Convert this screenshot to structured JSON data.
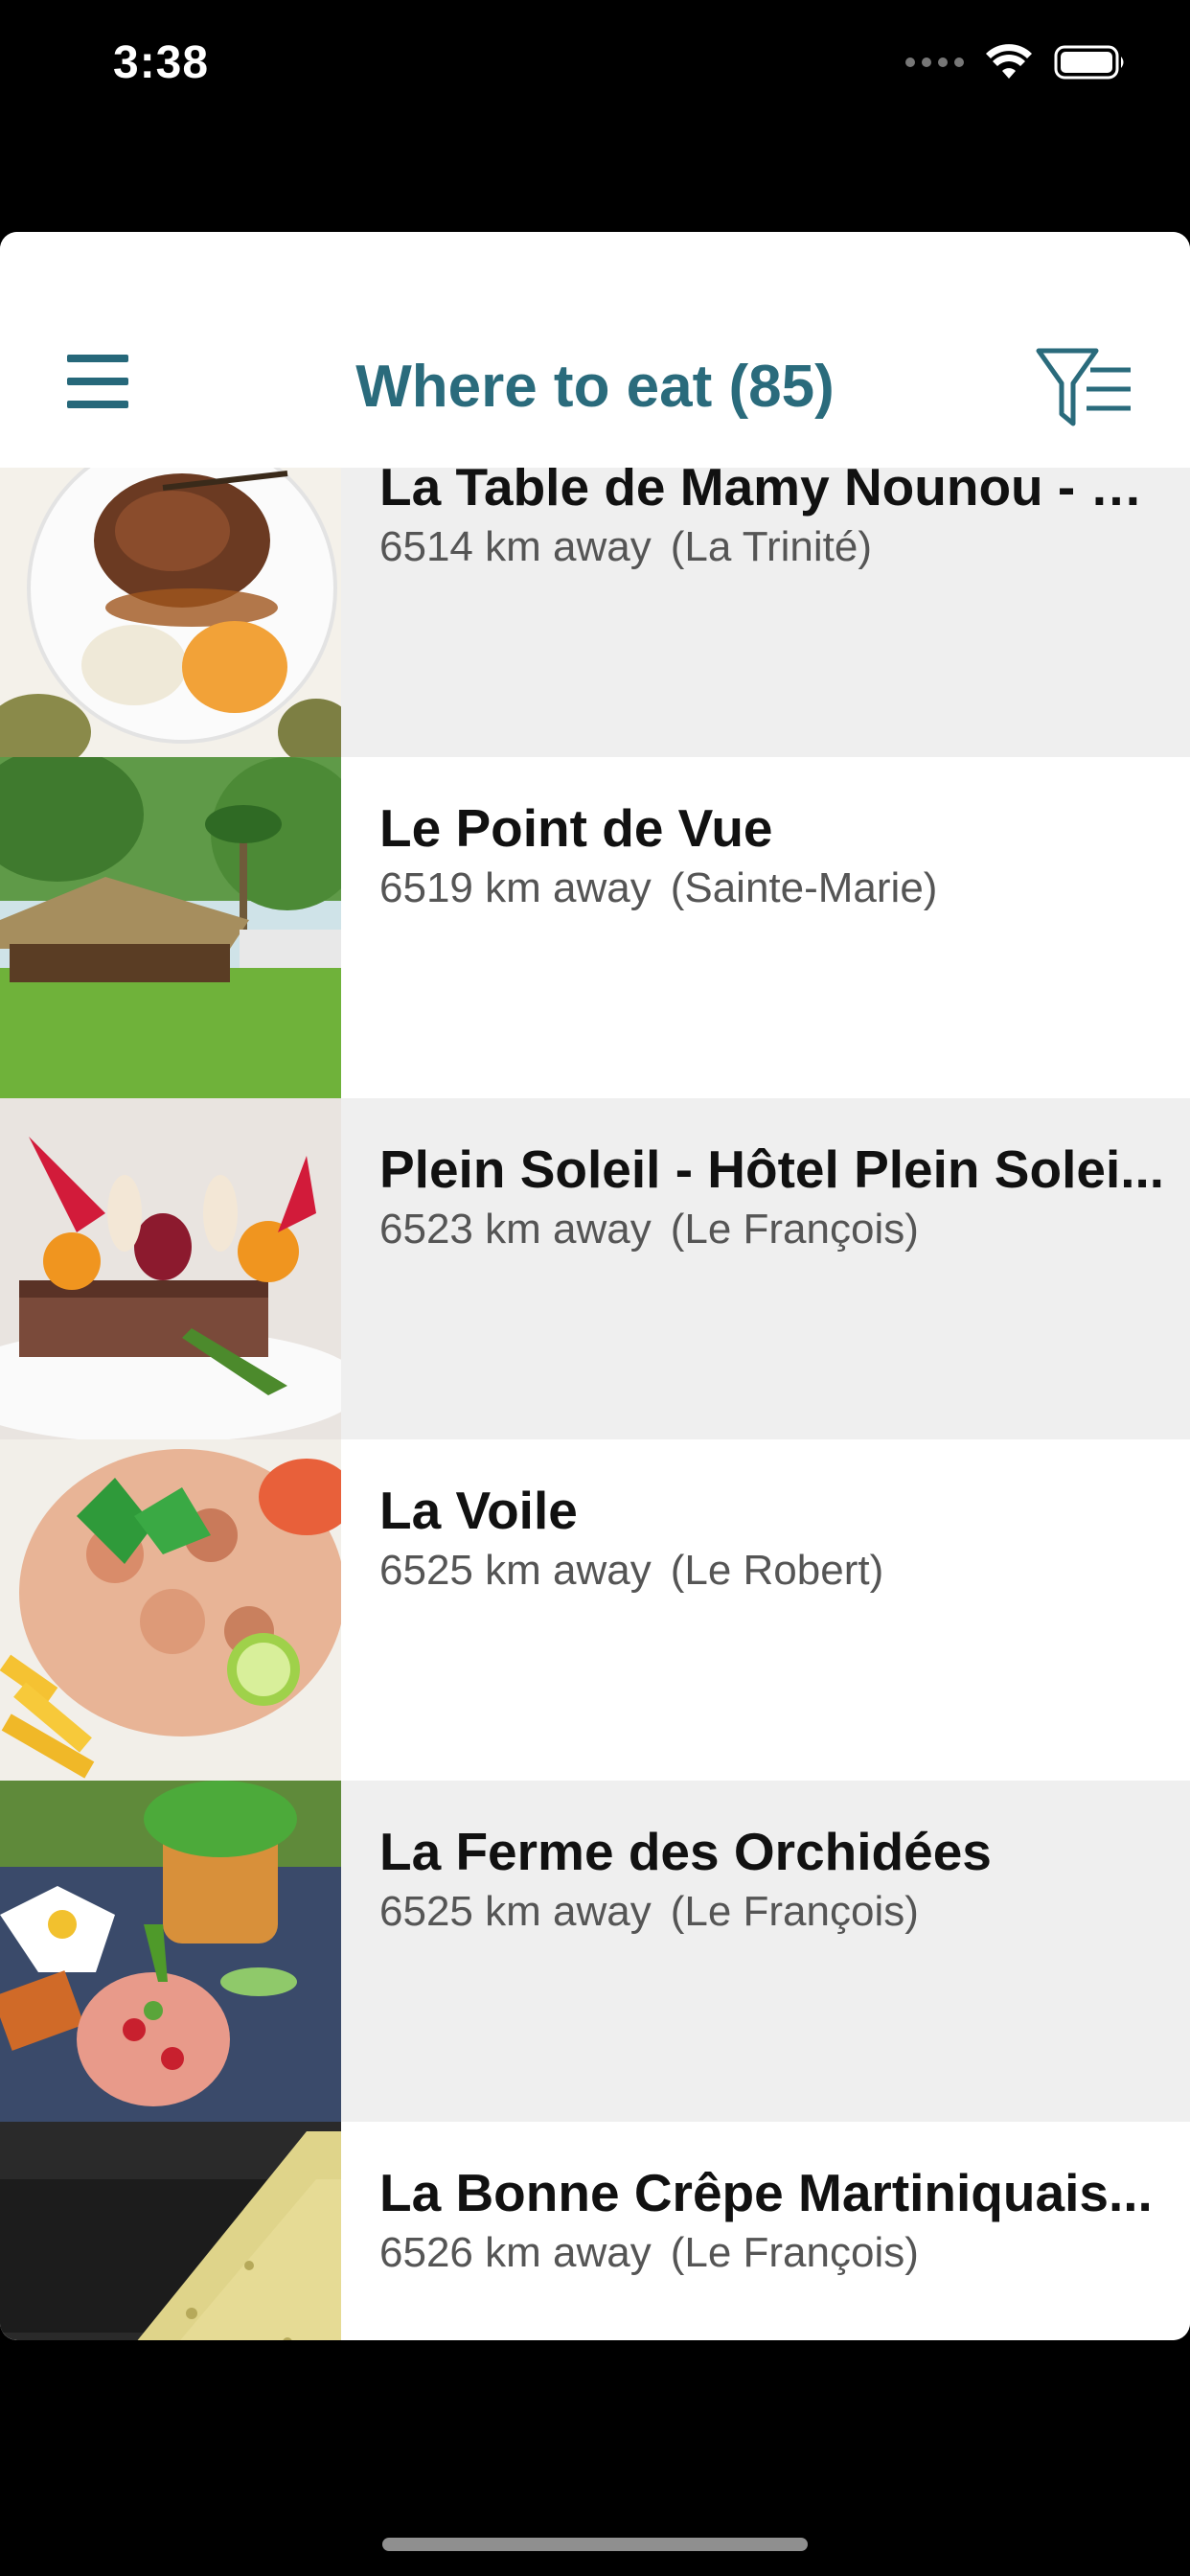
{
  "status_bar": {
    "time": "3:38",
    "icons": [
      "signal-icon",
      "wifi-icon",
      "battery-icon"
    ]
  },
  "header": {
    "title": "Where to eat (85)",
    "menu_icon": "hamburger-menu-icon",
    "filter_icon": "filter-list-icon"
  },
  "colors": {
    "accent": "#2a6b7c",
    "row_gray": "#efefef",
    "row_white": "#ffffff"
  },
  "restaurants": [
    {
      "name": "La Table de Mamy Nounou - H...",
      "distance": "6514 km away",
      "location": "(La Trinité)",
      "image": "plated-meat-photo"
    },
    {
      "name": "Le Point de Vue",
      "distance": "6519 km away",
      "location": "(Sainte-Marie)",
      "image": "thatched-hut-garden-photo"
    },
    {
      "name": "Plein Soleil - Hôtel Plein Solei...",
      "distance": "6523 km away",
      "location": "(Le François)",
      "image": "gourmet-dish-photo"
    },
    {
      "name": "La Voile",
      "distance": "6525 km away",
      "location": "(Le Robert)",
      "image": "tartare-with-fries-photo"
    },
    {
      "name": "La Ferme des Orchidées",
      "distance": "6525 km away",
      "location": "(Le François)",
      "image": "tropical-plate-flower-photo"
    },
    {
      "name": "La Bonne Crêpe Martiniquais...",
      "distance": "6526 km away",
      "location": "(Le François)",
      "image": "crepe-photo"
    }
  ]
}
